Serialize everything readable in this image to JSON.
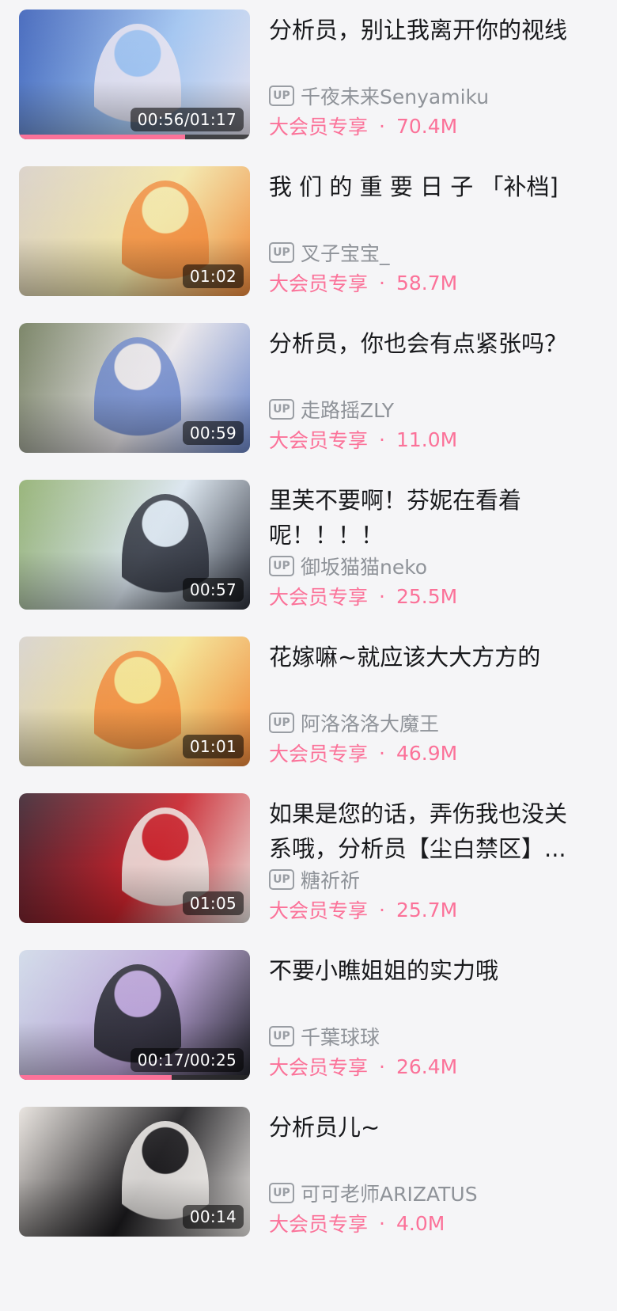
{
  "theme": {
    "accent": "#fb7299",
    "text": "#18191c",
    "muted": "#8f9399",
    "background": "#f5f5f7"
  },
  "videos": [
    {
      "title": "分析员，别让我离开你的视线",
      "uploader": "千夜未来Senyamiku",
      "badge": "大会员专享",
      "separator": "·",
      "views": "70.4M",
      "duration": "00:56/01:17",
      "progress": 0.72,
      "thumbnail_colors": [
        "#3a5fb8",
        "#9fc3f0",
        "#e9e4ef"
      ]
    },
    {
      "title": "我 们 的 重 要 日 子 「补档]",
      "uploader": "叉子宝宝_",
      "badge": "大会员专享",
      "separator": "·",
      "views": "58.7M",
      "duration": "01:02",
      "progress": null,
      "thumbnail_colors": [
        "#d8cfc6",
        "#f2e6a8",
        "#f08a3c"
      ]
    },
    {
      "title": "分析员，你也会有点紧张吗？",
      "uploader": "走路摇ZLY",
      "badge": "大会员专享",
      "separator": "·",
      "views": "11.0M",
      "duration": "00:59",
      "progress": null,
      "thumbnail_colors": [
        "#6f7a5a",
        "#e9e6ea",
        "#6b86c9"
      ]
    },
    {
      "title": "里芙不要啊！芬妮在看着\n呢！！！！",
      "uploader": "御坂猫猫neko",
      "badge": "大会员专享",
      "separator": "·",
      "views": "25.5M",
      "duration": "00:57",
      "progress": null,
      "thumbnail_colors": [
        "#8fae6e",
        "#d9e4ee",
        "#2b2f3a"
      ]
    },
    {
      "title": "花嫁嘛~就应该大大方方的",
      "uploader": "阿洛洛洛大魔王",
      "badge": "大会员专享",
      "separator": "·",
      "views": "46.9M",
      "duration": "01:01",
      "progress": null,
      "thumbnail_colors": [
        "#d6d1cc",
        "#f3e28f",
        "#f0883a"
      ]
    },
    {
      "title": "如果是您的话，弄伤我也没关\n系哦，分析员【尘白禁区】...",
      "uploader": "糖祈祈",
      "badge": "大会员专享",
      "separator": "·",
      "views": "25.7M",
      "duration": "01:05",
      "progress": null,
      "thumbnail_colors": [
        "#3b2430",
        "#c8232c",
        "#eeeae6"
      ]
    },
    {
      "title": "不要小瞧姐姐的实力哦",
      "uploader": "千葉球球",
      "badge": "大会员专享",
      "separator": "·",
      "views": "26.4M",
      "duration": "00:17/00:25",
      "progress": 0.66,
      "thumbnail_colors": [
        "#cfd9e8",
        "#b9a2d6",
        "#1f2128"
      ]
    },
    {
      "title": "分析员儿~",
      "uploader": "可可老师ARIZATUS",
      "badge": "大会员专享",
      "separator": "·",
      "views": "4.0M",
      "duration": "00:14",
      "progress": null,
      "thumbnail_colors": [
        "#e7e2dd",
        "#1c1b1e",
        "#f4f1ee"
      ]
    }
  ]
}
